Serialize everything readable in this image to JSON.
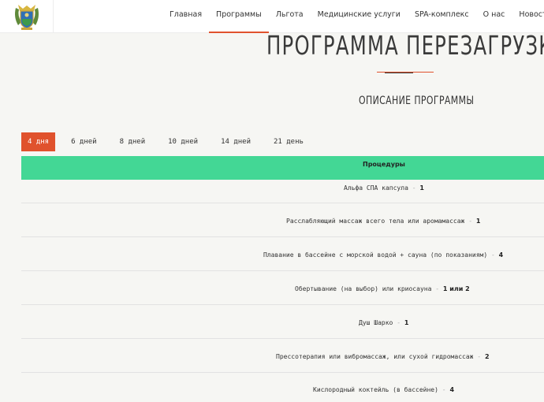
{
  "header": {
    "logo": "coat-of-arms",
    "nav": [
      {
        "label": "Главная",
        "active": false
      },
      {
        "label": "Программы",
        "active": true
      },
      {
        "label": "Льгота",
        "active": false
      },
      {
        "label": "Медицинские услуги",
        "active": false
      },
      {
        "label": "SPA-комплекс",
        "active": false
      },
      {
        "label": "О нас",
        "active": false
      },
      {
        "label": "Новости",
        "active": false
      }
    ]
  },
  "main": {
    "title": "Программа Перезагрузка",
    "subtitle": "ОПИСАНИЕ ПРОГРАММЫ",
    "tabs": [
      {
        "label": "4 дня",
        "active": true
      },
      {
        "label": "6 дней",
        "active": false
      },
      {
        "label": "8 дней",
        "active": false
      },
      {
        "label": "10 дней",
        "active": false
      },
      {
        "label": "14 дней",
        "active": false
      },
      {
        "label": "21 день",
        "active": false
      }
    ],
    "table": {
      "header": "Процедуры",
      "separator": "-",
      "rows": [
        {
          "name": "Альфа СПА капсула",
          "count": "1"
        },
        {
          "name": "Расслабляющий массаж всего тела или аромамассаж",
          "count": "1"
        },
        {
          "name": "Плавание в бассейне с морской водой + сауна (по показаниям)",
          "count": "4"
        },
        {
          "name": "Обертывание (на выбор) или криосауна",
          "count": "1 или 2"
        },
        {
          "name": "Душ Шарко",
          "count": "1"
        },
        {
          "name": "Прессотерапия или вибромассаж, или сухой гидромассаж",
          "count": "2"
        },
        {
          "name": "Кислородный коктейль (в бассейне)",
          "count": "4"
        }
      ]
    }
  },
  "colors": {
    "accent": "#e0522d",
    "table_header": "#43d795",
    "background": "#f6f6f3"
  }
}
